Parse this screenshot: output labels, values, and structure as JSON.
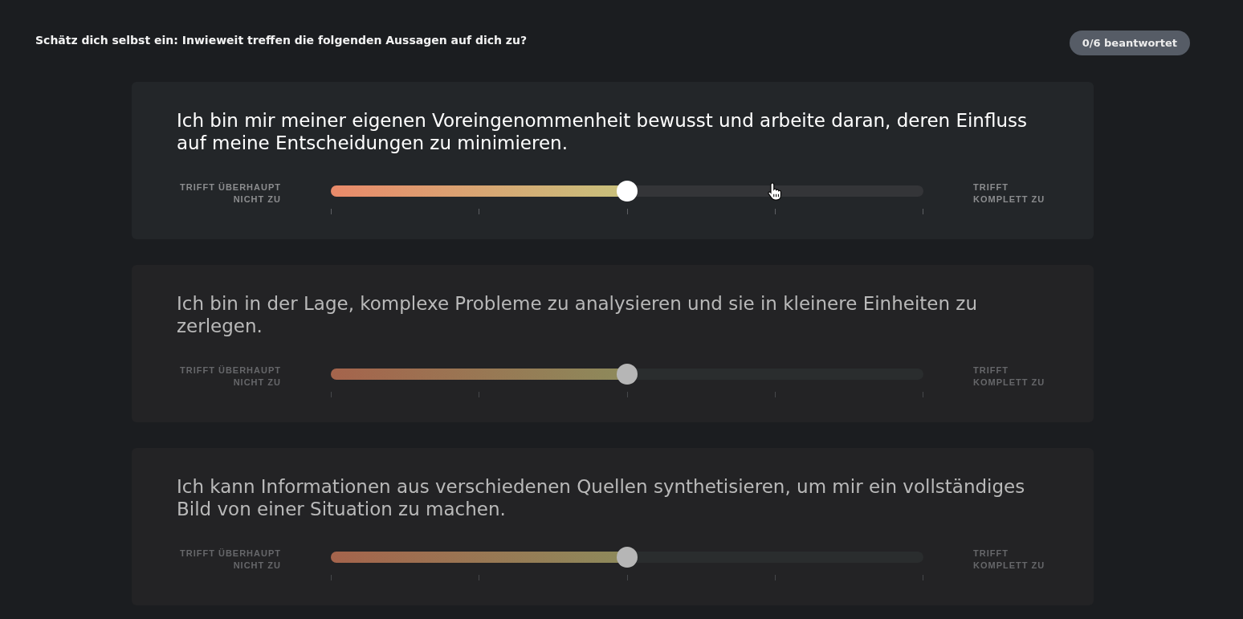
{
  "header": {
    "title": "Schätz dich selbst ein: Inwieweit treffen die folgenden Aussagen auf dich zu?",
    "progress": "0/6 beantwortet"
  },
  "questions": [
    {
      "text": "Ich bin mir meiner eigenen Voreingenommenheit bewusst und arbeite daran, deren Einfluss auf meine Entscheidungen zu minimieren.",
      "active": true,
      "min_label": "TRIFFT ÜBERHAUPT NICHT ZU",
      "max_label": "TRIFFT KOMPLETT ZU",
      "level": 0.5
    },
    {
      "text": "Ich bin in der Lage, komplexe Probleme zu analysieren und sie in kleinere Einheiten zu zerlegen.",
      "active": false,
      "min_label": "TRIFFT ÜBERHAUPT NICHT ZU",
      "max_label": "TRIFFT KOMPLETT ZU",
      "level": 0.5
    },
    {
      "text": "Ich kann Informationen aus verschiedenen Quellen synthetisieren, um mir ein vollständiges Bild von einer Situation zu machen.",
      "active": false,
      "min_label": "TRIFFT ÜBERHAUPT NICHT ZU",
      "max_label": "TRIFFT KOMPLETT ZU",
      "level": 0.5
    }
  ]
}
